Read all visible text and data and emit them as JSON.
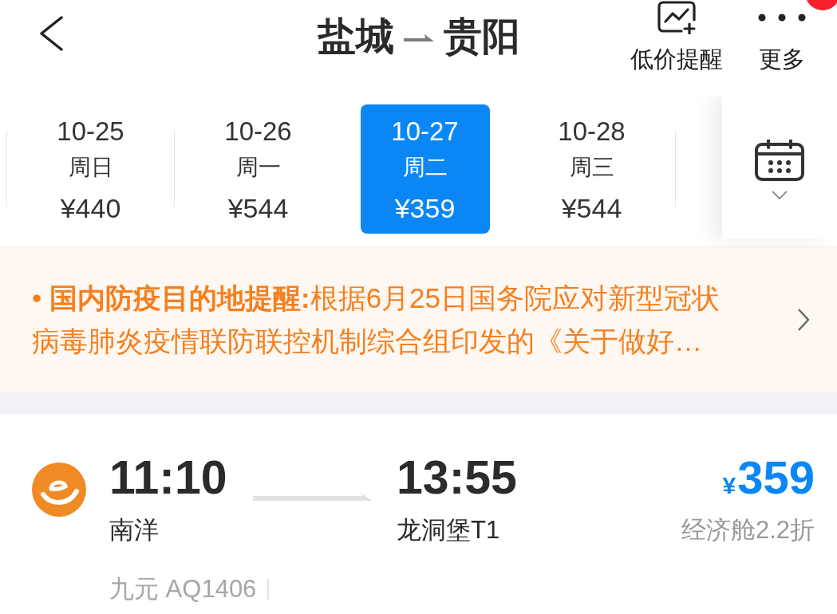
{
  "header": {
    "origin": "盐城",
    "destination": "贵阳",
    "actions": [
      {
        "kind": "price-alert",
        "label": "低价提醒",
        "badge": false
      },
      {
        "kind": "more",
        "label": "更多",
        "badge": true
      }
    ]
  },
  "dates": [
    {
      "date": "10-25",
      "weekday": "周日",
      "price": "¥440",
      "selected": false
    },
    {
      "date": "10-26",
      "weekday": "周一",
      "price": "¥544",
      "selected": false
    },
    {
      "date": "10-27",
      "weekday": "周二",
      "price": "¥359",
      "selected": true
    },
    {
      "date": "10-28",
      "weekday": "周三",
      "price": "¥544",
      "selected": false
    }
  ],
  "notice": {
    "text": "• **国内防疫目的地提醒:**根据6月25日国务院应对新型冠状病毒肺炎疫情联防联控机制综合组印发的《关于做好…"
  },
  "flights": [
    {
      "depart_time": "11:10",
      "depart_airport": "南洋",
      "arrive_time": "13:55",
      "arrive_airport": "龙洞堡T1",
      "currency": "¥",
      "price": "359",
      "cabin": "经济舱2.2折",
      "flight_info": "九元 AQ1406"
    }
  ]
}
